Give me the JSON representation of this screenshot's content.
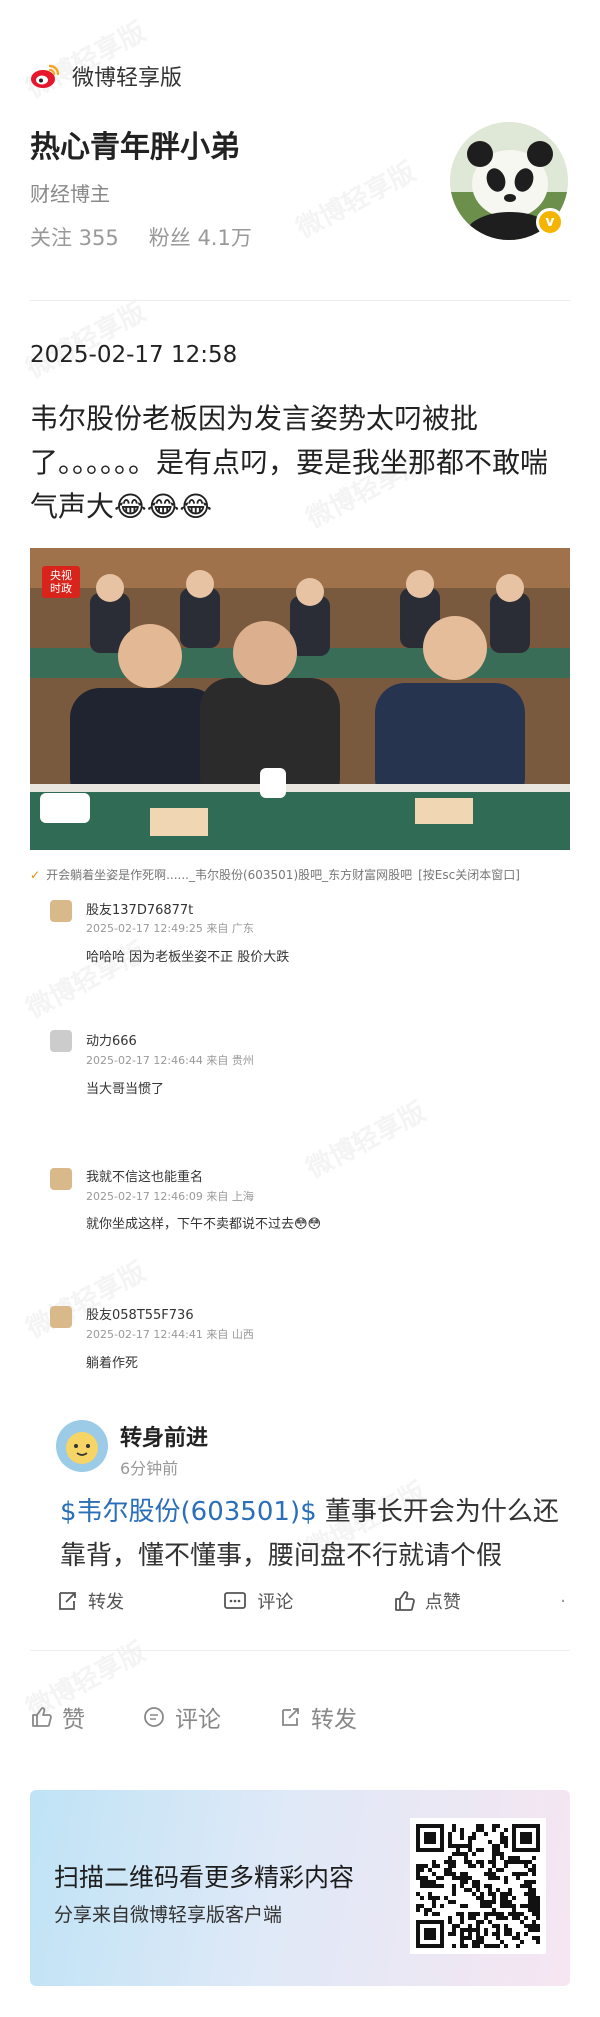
{
  "header": {
    "brand": "微博轻享版",
    "username": "热心青年胖小弟",
    "usertype": "财经博主",
    "follow_label": "关注 355",
    "fans_label": "粉丝 4.1万",
    "verified_badge": "v"
  },
  "post": {
    "date": "2025-02-17 12:58",
    "text": "韦尔股份老板因为发言姿势太叼被批了。。。。。。是有点叼，要是我坐那都不敢喘气声大😂😂😂"
  },
  "photo": {
    "cctv_logo": "央视 时政",
    "nameplates": [
      "",
      ""
    ]
  },
  "caption": {
    "icon": "✓",
    "text": "开会躺着坐姿是作死啊......_韦尔股份(603501)股吧_东方财富网股吧",
    "hint": "[按Esc关闭本窗口]"
  },
  "forum_comments": [
    {
      "name": "股友137D76877t",
      "meta": "2025-02-17 12:49:25  来自 广东",
      "text": "哈哈哈 因为老板坐姿不正 股价大跌"
    },
    {
      "name": "动力666",
      "meta": "2025-02-17 12:46:44  来自 贵州",
      "text": "当大哥当惯了"
    },
    {
      "name": "我就不信这也能重名",
      "meta": "2025-02-17 12:46:09  来自 上海",
      "text": "就你坐成这样，下午不卖都说不过去😳😳"
    },
    {
      "name": "股友058T55F736",
      "meta": "2025-02-17 12:44:41  来自 山西",
      "text": "躺着作死"
    }
  ],
  "repost": {
    "name": "转身前进",
    "time": "6分钟前",
    "tag": "$韦尔股份(603501)$",
    "text": " 董事长开会为什么还靠背，懂不懂事，腰间盘不行就请个假",
    "actions": {
      "repost": "转发",
      "comment": "评论",
      "like": "点赞",
      "more": "·"
    }
  },
  "bottom_actions": {
    "like": "赞",
    "comment": "评论",
    "repost": "转发"
  },
  "banner": {
    "title": "扫描二维码看更多精彩内容",
    "subtitle": "分享来自微博轻享版客户端"
  },
  "watermark": "微博轻享版",
  "colors": {
    "brand_red": "#e6162d",
    "link_blue": "#2a6fb8",
    "cctv_red": "#d9241c"
  }
}
